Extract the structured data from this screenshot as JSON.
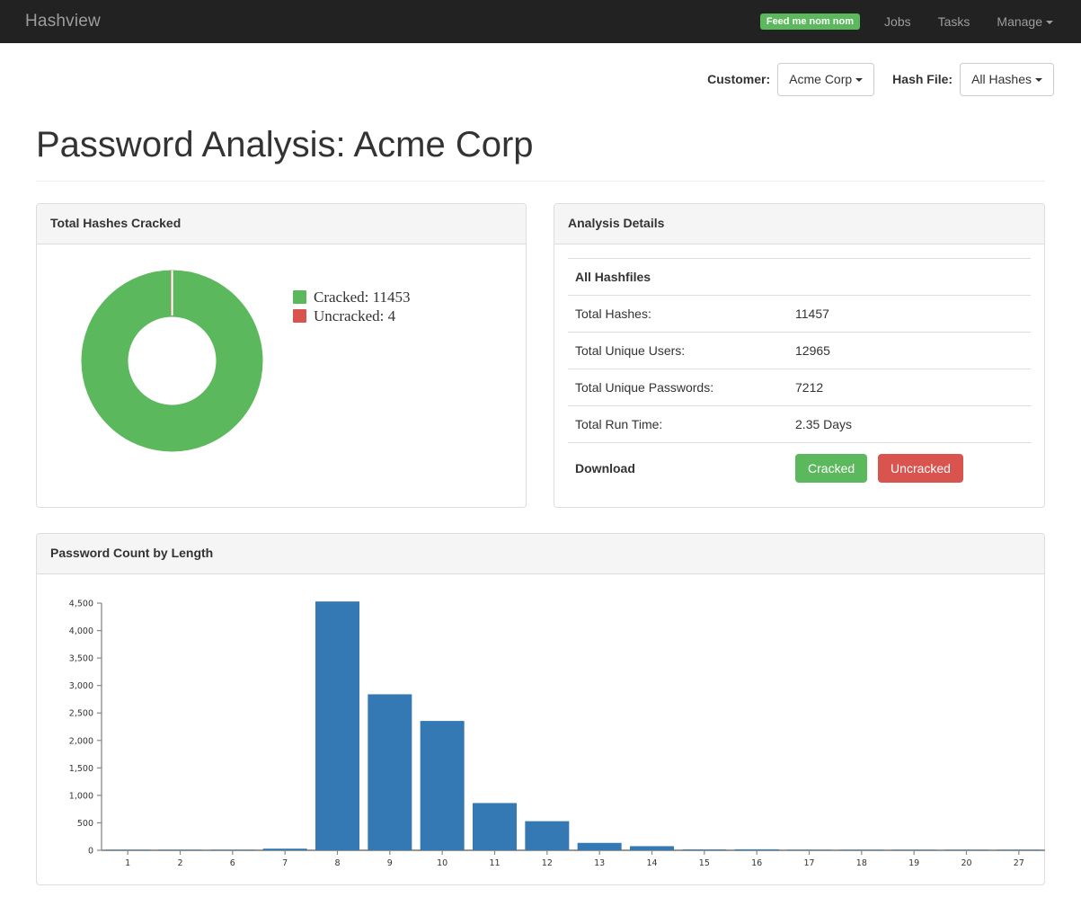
{
  "navbar": {
    "brand": "Hashview",
    "badge": "Feed me nom nom",
    "items": [
      {
        "label": "Jobs"
      },
      {
        "label": "Tasks"
      },
      {
        "label": "Manage"
      }
    ]
  },
  "selectors": {
    "customer_label": "Customer:",
    "customer_value": "Acme Corp",
    "hashfile_label": "Hash File:",
    "hashfile_value": "All Hashes"
  },
  "page": {
    "title": "Password Analysis: Acme Corp"
  },
  "cracked_panel": {
    "title": "Total Hashes Cracked",
    "legend": [
      {
        "label": "Cracked: 11453",
        "color": "#5cb85c"
      },
      {
        "label": "Uncracked: 4",
        "color": "#d9534f"
      }
    ]
  },
  "details_panel": {
    "title": "Analysis Details",
    "section_header": "All Hashfiles",
    "rows": [
      {
        "key": "Total Hashes:",
        "value": "11457"
      },
      {
        "key": "Total Unique Users:",
        "value": "12965"
      },
      {
        "key": "Total Unique Passwords:",
        "value": "7212"
      },
      {
        "key": "Total Run Time:",
        "value": "2.35 Days"
      }
    ],
    "download_label": "Download",
    "download_cracked": "Cracked",
    "download_uncracked": "Uncracked"
  },
  "length_panel": {
    "title": "Password Count by Length"
  },
  "chart_data": [
    {
      "type": "pie",
      "title": "Total Hashes Cracked",
      "labels": [
        "Cracked",
        "Uncracked"
      ],
      "values": [
        11453,
        4
      ],
      "colors": [
        "#5cb85c",
        "#d9534f"
      ],
      "donut": true,
      "legend_position": "right"
    },
    {
      "type": "bar",
      "title": "Password Count by Length",
      "xlabel": "",
      "ylabel": "",
      "categories": [
        "1",
        "2",
        "6",
        "7",
        "8",
        "9",
        "10",
        "11",
        "12",
        "13",
        "14",
        "15",
        "16",
        "17",
        "18",
        "19",
        "20",
        "27"
      ],
      "values": [
        0,
        0,
        2,
        30,
        4530,
        2840,
        2355,
        860,
        530,
        135,
        75,
        15,
        18,
        0,
        0,
        0,
        0,
        0
      ],
      "series": [
        {
          "name": "Password Count",
          "values": [
            0,
            0,
            2,
            30,
            4530,
            2840,
            2355,
            860,
            530,
            135,
            75,
            15,
            18,
            0,
            0,
            0,
            0,
            0
          ]
        }
      ],
      "ylim": [
        0,
        4500
      ],
      "yticks": [
        0,
        500,
        1000,
        1500,
        2000,
        2500,
        3000,
        3500,
        4000,
        4500
      ],
      "ytick_labels": [
        "0",
        "500",
        "1,000",
        "1,500",
        "2,000",
        "2,500",
        "3,000",
        "3,500",
        "4,000",
        "4,500"
      ],
      "bar_color": "#3579b4",
      "grid": false,
      "legend_position": "none"
    }
  ]
}
